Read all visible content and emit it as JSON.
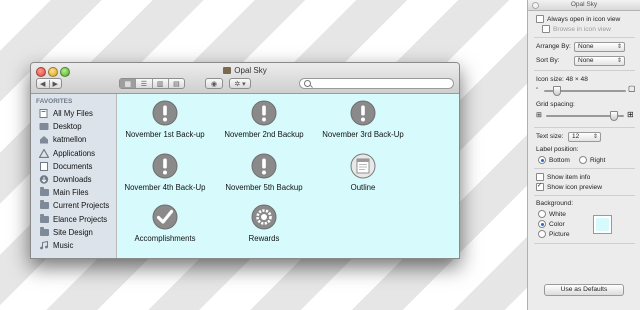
{
  "finder": {
    "title": "Opal Sky",
    "nav_back": "◀",
    "nav_forward": "▶",
    "view_icons": [
      "▦",
      "☰",
      "▥",
      "▤"
    ],
    "eye_button": "◉",
    "action_button": "✲ ▾",
    "search_placeholder": "",
    "sidebar_heading": "FAVORITES",
    "sidebar_items": [
      {
        "label": "All My Files",
        "icon": "all-files-icon"
      },
      {
        "label": "Desktop",
        "icon": "desktop-icon"
      },
      {
        "label": "katmellon",
        "icon": "home-icon"
      },
      {
        "label": "Applications",
        "icon": "applications-icon"
      },
      {
        "label": "Documents",
        "icon": "documents-icon"
      },
      {
        "label": "Downloads",
        "icon": "downloads-icon"
      },
      {
        "label": "Main Files",
        "icon": "folder-icon"
      },
      {
        "label": "Current Projects",
        "icon": "folder-icon"
      },
      {
        "label": "Elance Projects",
        "icon": "folder-icon"
      },
      {
        "label": "Site Design",
        "icon": "folder-icon"
      },
      {
        "label": "Music",
        "icon": "music-icon"
      }
    ],
    "background_color": "#d7fbfd",
    "files": [
      {
        "name": "November 1st Back-up",
        "icon": "alert-icon"
      },
      {
        "name": "November 2nd Backup",
        "icon": "alert-icon"
      },
      {
        "name": "November 3rd Back-Up",
        "icon": "alert-icon"
      },
      {
        "name": "November 4th Back-Up",
        "icon": "alert-icon"
      },
      {
        "name": "November 5th Backup",
        "icon": "alert-icon"
      },
      {
        "name": "Outline",
        "icon": "document-icon"
      },
      {
        "name": "Accomplishments",
        "icon": "checkmark-icon"
      },
      {
        "name": "Rewards",
        "icon": "gear-icon"
      }
    ]
  },
  "inspector": {
    "title": "Opal Sky",
    "always_open_label": "Always open in icon view",
    "always_open_checked": false,
    "browse_label": "Browse in icon view",
    "arrange_by_label": "Arrange By:",
    "arrange_by_value": "None",
    "sort_by_label": "Sort By:",
    "sort_by_value": "None",
    "icon_size_label": "Icon size:",
    "icon_size_value": "48 × 48",
    "grid_spacing_label": "Grid spacing:",
    "text_size_label": "Text size:",
    "text_size_value": "12",
    "label_position_label": "Label position:",
    "label_bottom": "Bottom",
    "label_right": "Right",
    "label_position_selected": "Bottom",
    "show_item_info_label": "Show item info",
    "show_item_info_checked": false,
    "show_icon_preview_label": "Show icon preview",
    "show_icon_preview_checked": true,
    "background_label": "Background:",
    "bg_white": "White",
    "bg_color": "Color",
    "bg_picture": "Picture",
    "background_selected": "Color",
    "defaults_button": "Use as Defaults"
  }
}
